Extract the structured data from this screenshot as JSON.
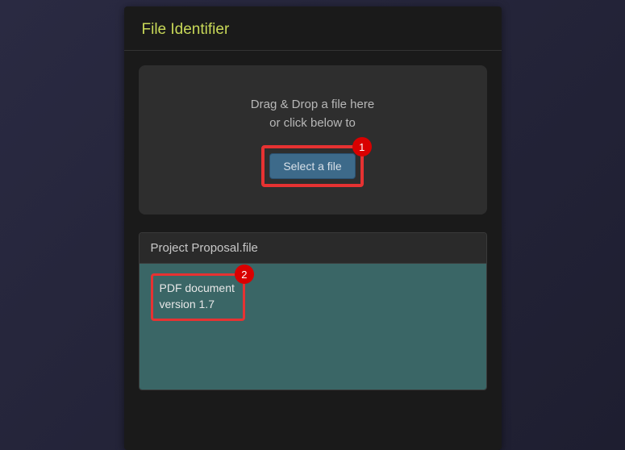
{
  "header": {
    "title": "File Identifier"
  },
  "dropzone": {
    "line1": "Drag & Drop a file here",
    "line2": "or click below to",
    "button_label": "Select a file",
    "badge": "1"
  },
  "result": {
    "filename": "Project Proposal.file",
    "badge": "2",
    "type_line1": "PDF document",
    "type_line2": "version 1.7"
  },
  "colors": {
    "accent": "#c8d858",
    "highlight": "#e63232",
    "badge_bg": "#d90000"
  }
}
